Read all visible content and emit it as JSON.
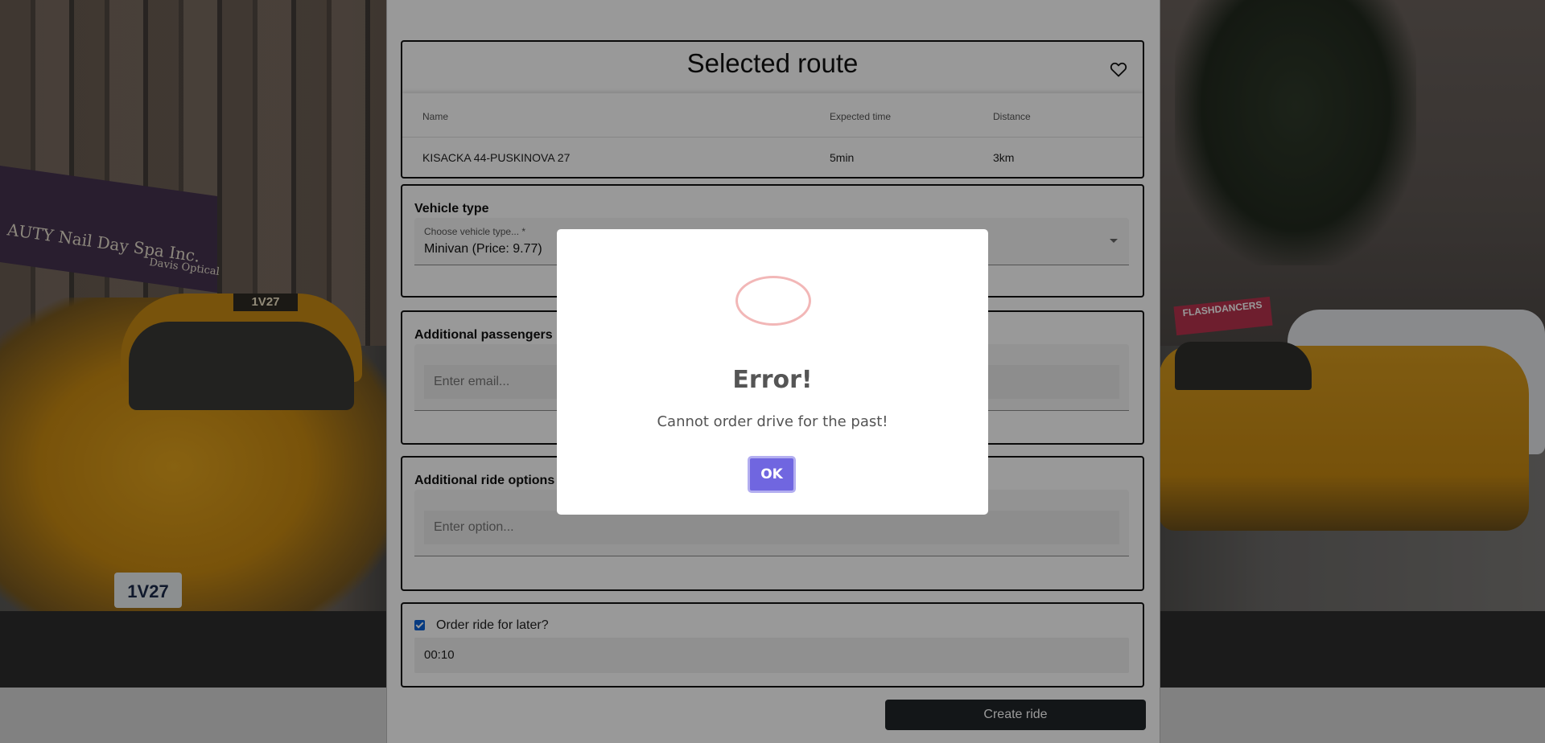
{
  "background": {
    "awning_text": "AUTY Nail Day Spa Inc.",
    "awning_sub": "Davis Optical",
    "taxi_sign_left": "1V27",
    "plate_left": "1V27",
    "sign_right": "FLASHDANCERS"
  },
  "route": {
    "title": "Selected route",
    "favorite_icon": "heart-icon",
    "headers": {
      "name": "Name",
      "expected_time": "Expected time",
      "distance": "Distance"
    },
    "row": {
      "name": "KISACKA 44-PUSKINOVA 27",
      "expected_time": "5min",
      "distance": "3km"
    }
  },
  "vehicle": {
    "label": "Vehicle type",
    "select_label": "Choose vehicle type... *",
    "select_value": "Minivan (Price: 9.77)"
  },
  "passengers": {
    "label": "Additional passengers",
    "placeholder": "Enter email..."
  },
  "options": {
    "label": "Additional ride options",
    "placeholder": "Enter option..."
  },
  "later": {
    "checked": true,
    "label": "Order ride for later?",
    "time": "00:10"
  },
  "actions": {
    "create": "Create ride"
  },
  "modal": {
    "title": "Error!",
    "text": "Cannot order drive for the past!",
    "ok": "OK",
    "accent": "#7066e0",
    "error_color": "#f2b7b7"
  }
}
